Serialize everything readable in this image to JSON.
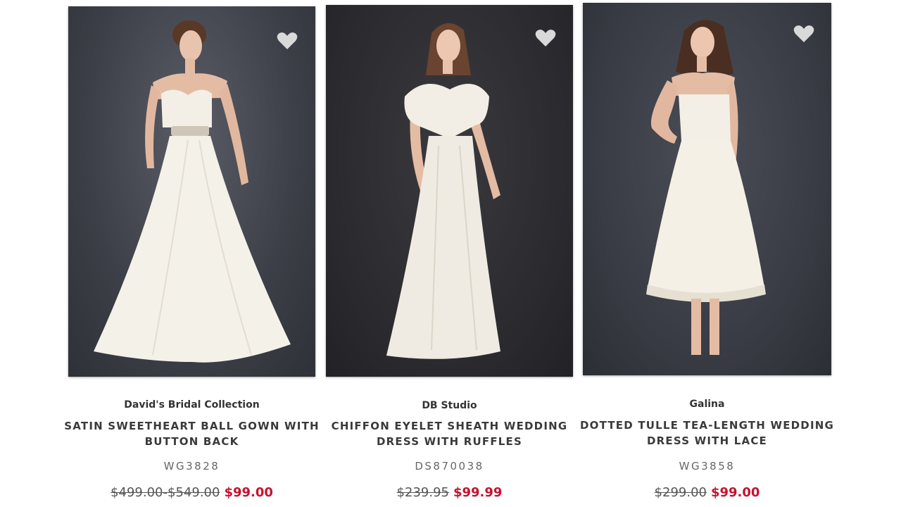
{
  "products": [
    {
      "brand": "David's Bridal Collection",
      "name": "SATIN SWEETHEART BALL GOWN WITH BUTTON BACK",
      "sku": "WG3828",
      "original_price": "$499.00-$549.00",
      "sale_price": "$99.00"
    },
    {
      "brand": "DB Studio",
      "name": "CHIFFON EYELET SHEATH WEDDING DRESS WITH RUFFLES",
      "sku": "DS870038",
      "original_price": "$239.95",
      "sale_price": "$99.99"
    },
    {
      "brand": "Galina",
      "name": "DOTTED TULLE TEA-LENGTH WEDDING DRESS WITH LACE",
      "sku": "WG3858",
      "original_price": "$299.00",
      "sale_price": "$99.00"
    }
  ],
  "icons": {
    "favorite": "heart-icon"
  },
  "colors": {
    "sale_price": "#c8102e",
    "brand_text": "#333333",
    "heart": "#d9d9d9"
  }
}
